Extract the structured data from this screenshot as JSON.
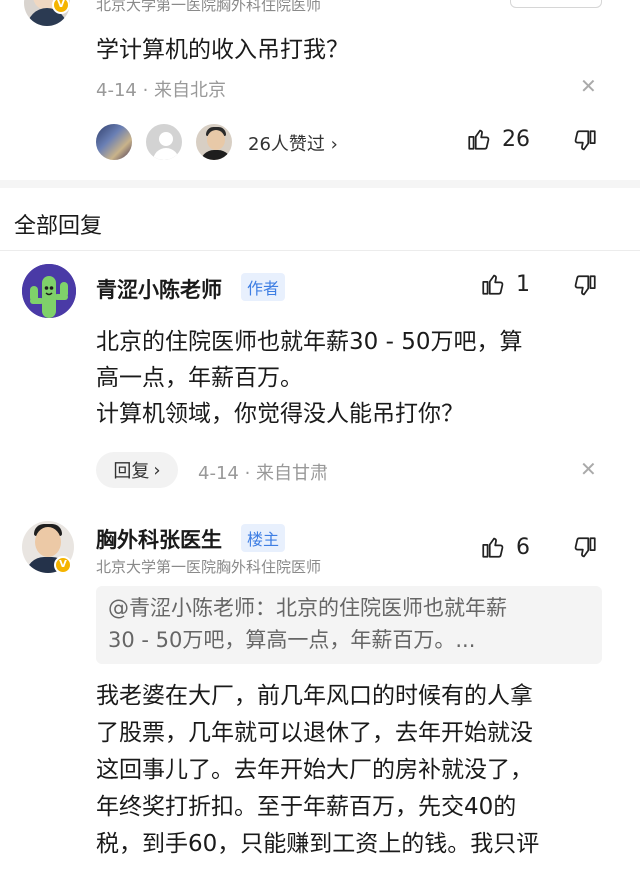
{
  "top_comment": {
    "author_title": "北京大学第一医院胸外科住院医师",
    "text": "学计算机的收入吊打我？",
    "date": "4-14",
    "location": "来自北京",
    "likers_text": "26人赞过",
    "likes": "26",
    "close_icon": "close-icon"
  },
  "section_title": "全部回复",
  "replies": [
    {
      "author": "青涩小陈老师",
      "tag": "作者",
      "likes": "1",
      "text_lines": [
        "北京的住院医师也就年薪30 - 50万吧，算",
        "高一点，年薪百万。",
        "计算机领域，你觉得没人能吊打你？"
      ],
      "reply_label": "回复",
      "date": "4-14",
      "location": "来自甘肃"
    },
    {
      "author": "胸外科张医生",
      "tag": "楼主",
      "subtitle": "北京大学第一医院胸外科住院医师",
      "likes": "6",
      "quote_lines": [
        "@青涩小陈老师：北京的住院医师也就年薪",
        "30 - 50万吧，算高一点，年薪百万。..."
      ],
      "text_lines": [
        "我老婆在大厂，前几年风口的时候有的人拿",
        "了股票，几年就可以退休了，去年开始就没",
        "这回事儿了。去年开始大厂的房补就没了，",
        "年终奖打折扣。至于年薪百万，先交40的",
        "税，到手60，只能赚到工资上的钱。我只评"
      ]
    }
  ],
  "colors": {
    "accent_blue": "#3e7ee3",
    "verified_badge": "#f5b400",
    "meta_gray": "#999999"
  }
}
